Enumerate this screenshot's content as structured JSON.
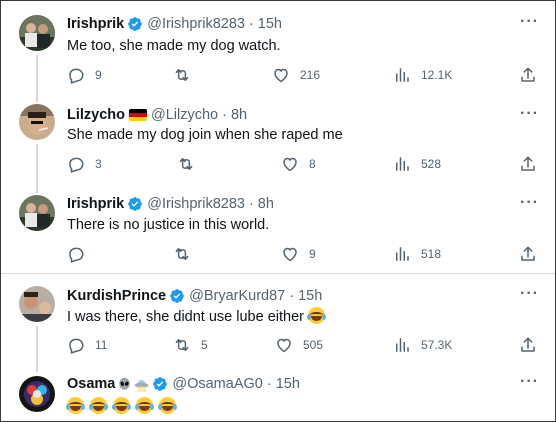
{
  "tweets": [
    {
      "name": "Irishprik",
      "handle": "@Irishprik8283",
      "time": "15h",
      "text": "Me too, she made my dog watch.",
      "replies": "9",
      "retweets": "",
      "likes": "216",
      "views": "12.1K",
      "more": "···"
    },
    {
      "name": "Lilzycho",
      "handle": "@Lilzycho",
      "time": "8h",
      "text": "She made my dog join when she raped me",
      "replies": "3",
      "retweets": "",
      "likes": "8",
      "views": "528",
      "more": "···"
    },
    {
      "name": "Irishprik",
      "handle": "@Irishprik8283",
      "time": "8h",
      "text": "There is no justice in this world.",
      "replies": "",
      "retweets": "",
      "likes": "9",
      "views": "518",
      "more": "···"
    },
    {
      "name": "KurdishPrince",
      "handle": "@BryarKurd87",
      "time": "15h",
      "text": "I was there, she didnt use lube either",
      "replies": "11",
      "retweets": "5",
      "likes": "505",
      "views": "57.3K",
      "more": "···"
    },
    {
      "name": "Osama",
      "handle": "@OsamaAG0",
      "time": "15h",
      "text": "",
      "more": "···"
    }
  ],
  "separator_dot": "·",
  "colors": {
    "verified": "#1d9bf0",
    "muted": "#536471",
    "text": "#0f1419",
    "line": "#cfd9de"
  },
  "icons": [
    "reply-icon",
    "retweet-icon",
    "like-icon",
    "views-icon",
    "share-icon",
    "verified-badge-icon",
    "germany-flag-icon",
    "alien-emoji-icon",
    "ufo-emoji-icon",
    "laughing-crying-emoji-icon"
  ]
}
